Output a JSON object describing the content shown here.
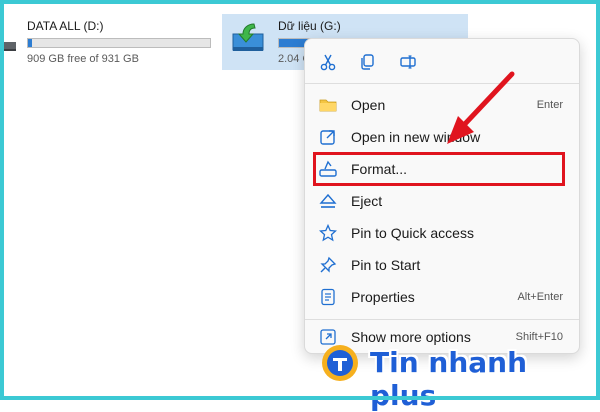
{
  "drives": [
    {
      "name": "DATA ALL (D:)",
      "size_text": "909 GB free of 931 GB",
      "used_fraction": 0.02,
      "selected": false
    },
    {
      "name": "Dữ liệu (G:)",
      "size_text": "2.04 G",
      "used_fraction": 0.52,
      "selected": true
    }
  ],
  "context_menu": {
    "toolbar": [
      {
        "icon": "scissors-icon",
        "action": "cut"
      },
      {
        "icon": "copy-icon",
        "action": "copy"
      },
      {
        "icon": "rename-icon",
        "action": "rename"
      }
    ],
    "items": [
      {
        "label": "Open",
        "shortcut": "Enter",
        "icon": "folder-icon"
      },
      {
        "label": "Open in new window",
        "shortcut": "",
        "icon": "open-new-window-icon"
      },
      {
        "label": "Format...",
        "shortcut": "",
        "icon": "format-drive-icon"
      },
      {
        "label": "Eject",
        "shortcut": "",
        "icon": "eject-icon"
      },
      {
        "label": "Pin to Quick access",
        "shortcut": "",
        "icon": "star-icon"
      },
      {
        "label": "Pin to Start",
        "shortcut": "",
        "icon": "pin-icon"
      },
      {
        "label": "Properties",
        "shortcut": "Alt+Enter",
        "icon": "properties-icon"
      },
      {
        "label": "Show more options",
        "shortcut": "Shift+F10",
        "icon": "more-options-icon"
      }
    ]
  },
  "annotation": {
    "highlight_color": "#e0141e",
    "target": "Format..."
  },
  "watermark": {
    "text": "Tin nhanh plus"
  },
  "colors": {
    "frame": "#3cc9d4",
    "accent": "#2d7dd2",
    "selection": "#cfe3f5"
  }
}
